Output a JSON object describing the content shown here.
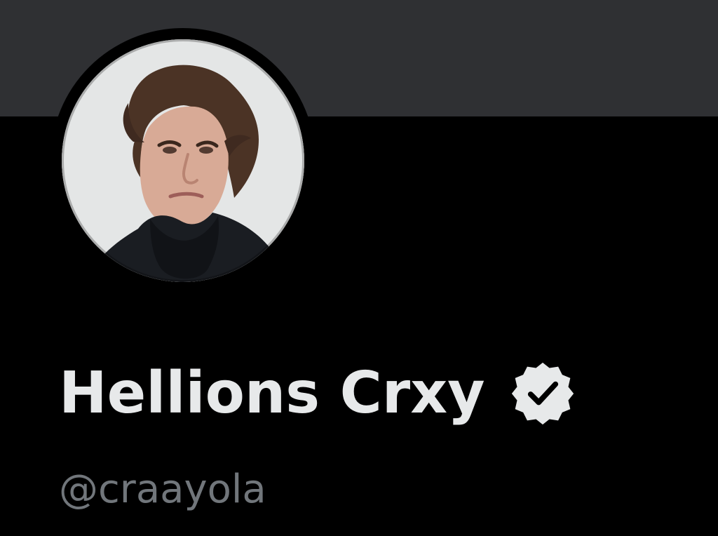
{
  "profile": {
    "display_name": "Hellions Crxy",
    "handle": "@craayola",
    "verified_icon": "verified-badge-icon",
    "avatar_icon": "profile-photo"
  },
  "colors": {
    "background": "#000000",
    "banner": "#2f3033",
    "name_text": "#e7e9ea",
    "handle_text": "#71767b",
    "badge_fill": "#e7e9ea",
    "badge_check": "#000000"
  }
}
